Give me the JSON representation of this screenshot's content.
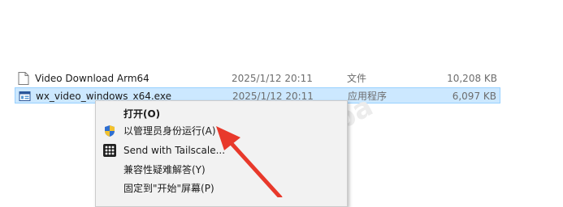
{
  "files": [
    {
      "name": "Video Download Arm64",
      "date": "2025/1/12 20:11",
      "type": "文件",
      "size": "10,208 KB",
      "icon": "generic-file-icon"
    },
    {
      "name": "wx_video_windows_x64.exe",
      "date": "2025/1/12 20:11",
      "type": "应用程序",
      "size": "6,097 KB",
      "icon": "exe-app-icon"
    }
  ],
  "context_menu": {
    "items": [
      {
        "label": "打开(O)",
        "icon": "",
        "bold": true
      },
      {
        "label": "以管理员身份运行(A)",
        "icon": "uac-shield-icon"
      },
      {
        "label": "Send with Tailscale...",
        "icon": "tailscale-icon"
      },
      {
        "label": "兼容性疑难解答(Y)",
        "icon": ""
      },
      {
        "label": "固定到\"开始\"屏幕(P)",
        "icon": ""
      }
    ]
  },
  "colors": {
    "selection": "#cce8ff",
    "arrow": "#e8392b"
  }
}
